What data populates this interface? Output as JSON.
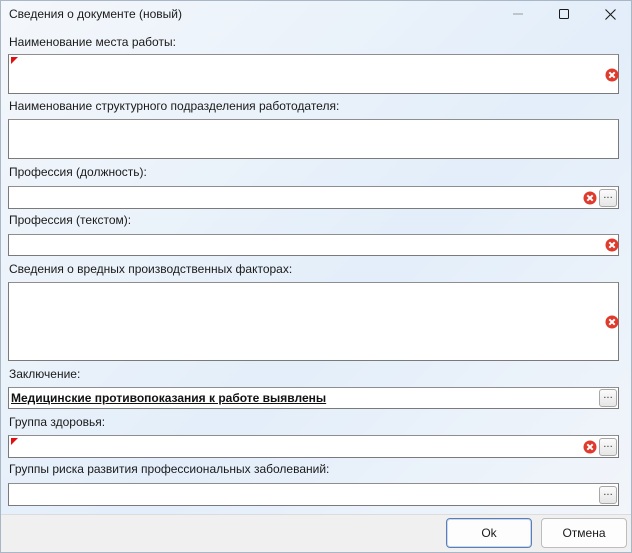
{
  "window": {
    "title": "Сведения о документе (новый)"
  },
  "form": {
    "workplace_label": "Наименование места работы:",
    "department_label": "Наименование структурного подразделения работодателя:",
    "profession_label": "Профессия (должность):",
    "profession_text_label": "Профессия (текстом):",
    "hazards_label": "Сведения о вредных производственных факторах:",
    "conclusion_label": "Заключение:",
    "conclusion_value": "Медицинские противопоказания к работе выявлены",
    "health_group_label": "Группа здоровья:",
    "risk_groups_label": "Группы риска развития профессиональных заболеваний:",
    "ellipsis": "..."
  },
  "buttons": {
    "ok": "Ok",
    "cancel": "Отмена"
  },
  "colors": {
    "error": "#e03a2c",
    "required_marker": "#e01010",
    "default_button_border": "#5b7fb5"
  }
}
